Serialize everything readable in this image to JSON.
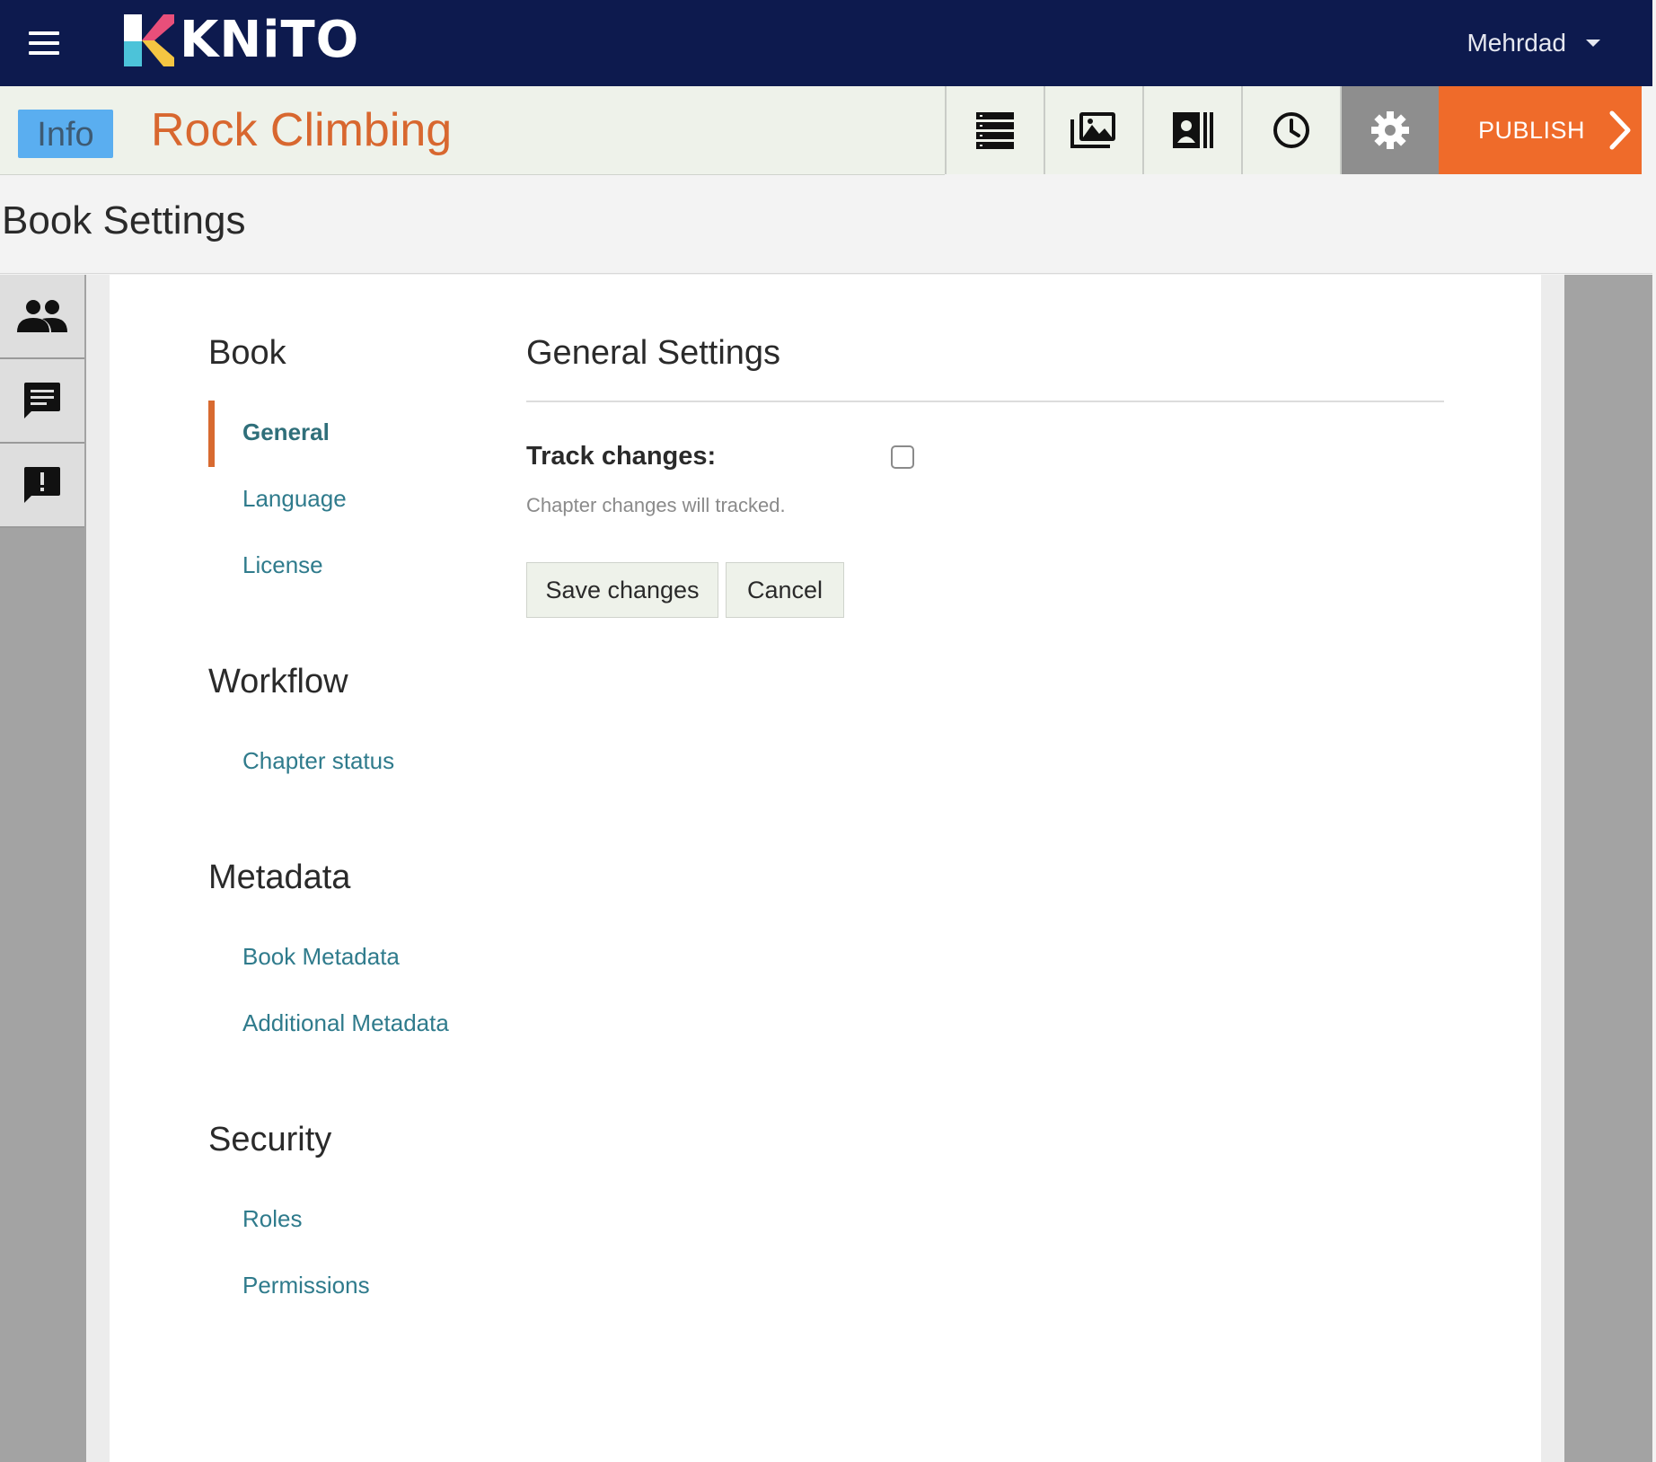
{
  "app": {
    "brand": "KNiTO",
    "user_name": "Mehrdad"
  },
  "book": {
    "info_label": "Info",
    "title": "Rock Climbing"
  },
  "toolbar": {
    "items": [
      {
        "icon": "list-icon",
        "active": false
      },
      {
        "icon": "images-icon",
        "active": false
      },
      {
        "icon": "book-template-icon",
        "active": false
      },
      {
        "icon": "clock-icon",
        "active": false
      },
      {
        "icon": "gear-icon",
        "active": true
      }
    ],
    "publish_label": "PUBLISH"
  },
  "page": {
    "title": "Book Settings"
  },
  "rail": {
    "items": [
      "team-icon",
      "comments-icon",
      "feedback-icon"
    ]
  },
  "nav": {
    "sections": [
      {
        "title": "Book",
        "links": [
          "General",
          "Language",
          "License"
        ]
      },
      {
        "title": "Workflow",
        "links": [
          "Chapter status"
        ]
      },
      {
        "title": "Metadata",
        "links": [
          "Book Metadata",
          "Additional Metadata"
        ]
      },
      {
        "title": "Security",
        "links": [
          "Roles",
          "Permissions"
        ]
      }
    ],
    "active_link": "General"
  },
  "panel": {
    "title": "General Settings",
    "track_changes_label": "Track changes:",
    "track_changes_checked": false,
    "track_changes_help": "Chapter changes will tracked.",
    "save_label": "Save changes",
    "cancel_label": "Cancel"
  },
  "colors": {
    "topbar": "#0d1a4e",
    "accent_orange": "#ef6b2a",
    "title_orange": "#d8672f",
    "info_blue": "#5aaef0",
    "link_teal": "#2f7b8c"
  }
}
